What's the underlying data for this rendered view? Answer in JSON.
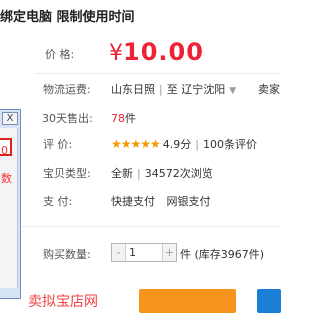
{
  "product": {
    "title": "绑定电脑 限制使用时间"
  },
  "price": {
    "label": "价      格:",
    "symbol": "¥",
    "amount": "10.00"
  },
  "shipping": {
    "label": "物流运费:",
    "from": "山东日照",
    "separator": "|",
    "to_prefix": "至",
    "to": "辽宁沈阳",
    "fee_frag": "卖家"
  },
  "sales": {
    "label": "30天售出:",
    "count": "78",
    "unit": "件"
  },
  "rating": {
    "label": "评      价:",
    "stars": "★★★★★",
    "score": "4.9分",
    "separator": "|",
    "reviews": "100条评价"
  },
  "item_type": {
    "label": "宝贝类型:",
    "condition": "全新",
    "separator": "|",
    "views": "34572次浏览"
  },
  "payment": {
    "label": "支      付:",
    "methods": [
      "快捷支付",
      "网银支付"
    ]
  },
  "quantity": {
    "label": "购买数量:",
    "minus": "-",
    "value": "1",
    "plus": "+",
    "stock_text": "件 (库存3967件)"
  },
  "left_window": {
    "close": "X",
    "frag_top": "0",
    "frag_mid": "数"
  },
  "bottom_text": "卖拟宝店网",
  "icons": {
    "dropdown": "chevron-down-icon",
    "window_close": "close-icon"
  },
  "colors": {
    "price": "#ee2233",
    "accent_orange": "#f7941d",
    "accent_blue": "#1b7fd5",
    "stars": "#f39800"
  }
}
